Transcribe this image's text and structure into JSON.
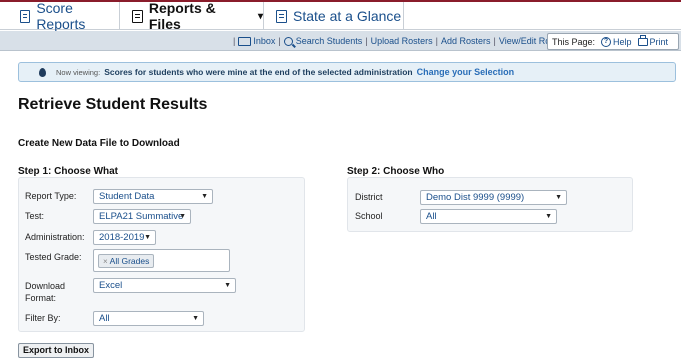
{
  "topnav": {
    "tabs": [
      {
        "label": "Score Reports"
      },
      {
        "label": "Reports & Files",
        "caret": "▾"
      },
      {
        "label": "State at a Glance"
      }
    ]
  },
  "utilbar": {
    "links": [
      "Inbox",
      "Search Students",
      "Upload Rosters",
      "Add Rosters",
      "View/Edit Rosters"
    ],
    "this_page": "This Page:",
    "help": "Help",
    "print": "Print"
  },
  "banner": {
    "now_viewing": "Now viewing:",
    "text": "Scores for students who were mine at the end of the selected administration",
    "link": "Change your Selection"
  },
  "page": {
    "title": "Retrieve Student Results",
    "subtitle": "Create New Data File to Download"
  },
  "step1": {
    "heading": "Step 1: Choose What",
    "fields": [
      {
        "label": "Report Type:",
        "value": "Student Data"
      },
      {
        "label": "Test:",
        "value": "ELPA21 Summative"
      },
      {
        "label": "Administration:",
        "value": "2018-2019"
      },
      {
        "label": "Tested Grade:",
        "value": "All Grades"
      },
      {
        "label": "Download Format:",
        "value": "Excel"
      },
      {
        "label": "Filter By:",
        "value": "All"
      }
    ]
  },
  "step2": {
    "heading": "Step 2: Choose Who",
    "fields": [
      {
        "label": "District",
        "value": "Demo Dist 9999 (9999)"
      },
      {
        "label": "School",
        "value": "All"
      }
    ]
  },
  "export_button": "Export to Inbox",
  "colors": {
    "accent": "#8a1c2b",
    "link": "#1a4f8b",
    "banner_bg": "#e6f0f7"
  }
}
